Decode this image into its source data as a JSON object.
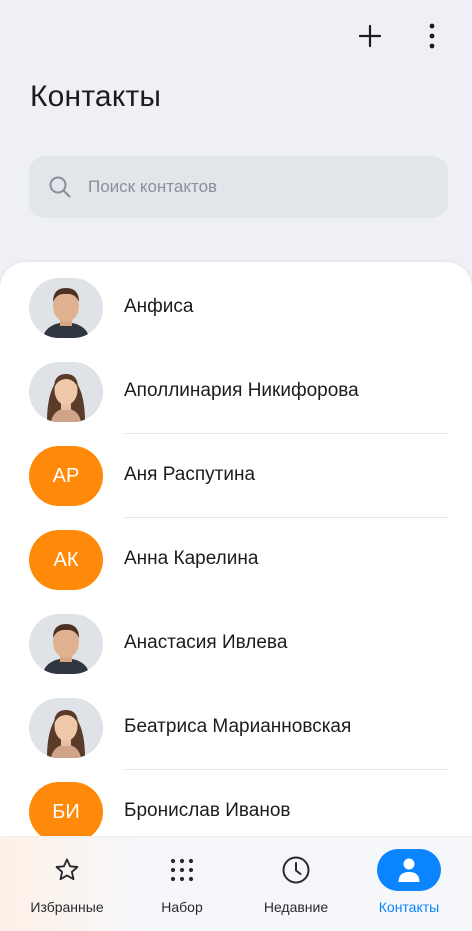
{
  "header": {
    "title": "Контакты",
    "add_icon": "plus-icon",
    "more_icon": "more-vertical-icon"
  },
  "search": {
    "placeholder": "Поиск контактов",
    "icon": "search-icon"
  },
  "contacts": [
    {
      "name": "Анфиса",
      "avatar": "photo-male"
    },
    {
      "name": "Аполлинария Никифорова",
      "avatar": "photo-female"
    },
    {
      "name": "Аня Распутина",
      "avatar": "initials",
      "initials": "АР"
    },
    {
      "name": "Анна Карелина",
      "avatar": "initials",
      "initials": "АК"
    },
    {
      "name": "Анастасия Ивлева",
      "avatar": "photo-male"
    },
    {
      "name": "Беатриса Марианновская",
      "avatar": "photo-female"
    },
    {
      "name": "Бронислав Иванов",
      "avatar": "initials",
      "initials": "БИ"
    }
  ],
  "bottom_nav": [
    {
      "label": "Избранные",
      "icon": "star-icon",
      "active": false
    },
    {
      "label": "Набор",
      "icon": "dialpad-icon",
      "active": false
    },
    {
      "label": "Недавние",
      "icon": "clock-icon",
      "active": false
    },
    {
      "label": "Контакты",
      "icon": "person-icon",
      "active": true
    }
  ],
  "colors": {
    "accent": "#0a84ff",
    "initials_avatar": "#ff8a0a",
    "background": "#eef0f5"
  }
}
